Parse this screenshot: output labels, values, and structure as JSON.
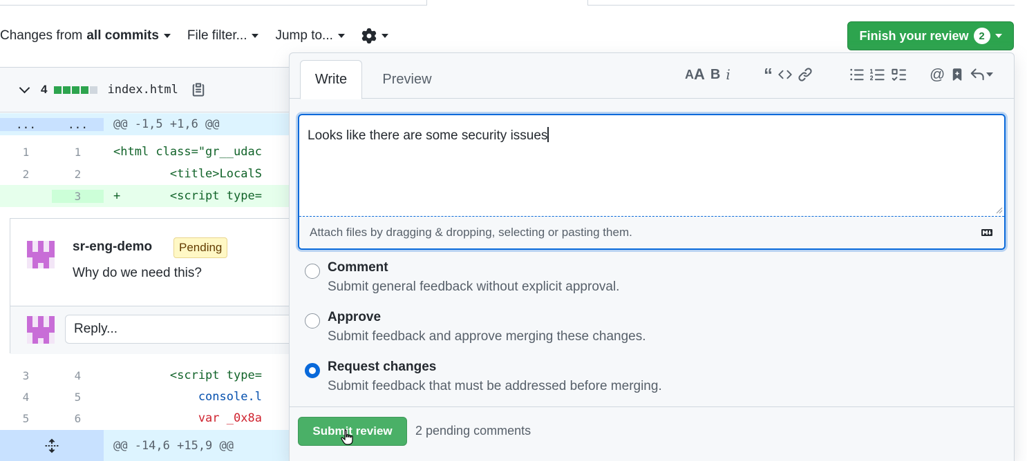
{
  "toolbar": {
    "changes_prefix": "Changes from",
    "changes_value": "all commits",
    "file_filter": "File filter...",
    "jump_to": "Jump to...",
    "finish_review": "Finish your review",
    "finish_count": "2"
  },
  "file": {
    "change_count": "4",
    "name": "index.html"
  },
  "diff_top": [
    {
      "type": "hunk",
      "old": "...",
      "new": "...",
      "code": "@@ -1,5 +1,6 @@"
    },
    {
      "type": "context",
      "old": "1",
      "new": "1",
      "code": "<html class=\"gr__udac"
    },
    {
      "type": "context",
      "old": "2",
      "new": "2",
      "code": "        <title>LocalS"
    },
    {
      "type": "added",
      "old": "",
      "new": "3",
      "code": "+       <script type="
    }
  ],
  "thread": {
    "author": "sr-eng-demo",
    "badge": "Pending",
    "body": "Why do we need this?",
    "reply_placeholder": "Reply..."
  },
  "diff_bottom": [
    {
      "type": "context",
      "old": "3",
      "new": "4",
      "code": "        <script type="
    },
    {
      "type": "context",
      "old": "4",
      "new": "5",
      "code": "            console.l"
    },
    {
      "type": "context",
      "old": "5",
      "new": "6",
      "code": "            var _0x8a"
    },
    {
      "type": "hunk",
      "old": "",
      "new": "",
      "code": "@@ -14,6 +15,9 @@"
    }
  ],
  "review": {
    "tabs": [
      "Write",
      "Preview"
    ],
    "text": "Looks like there are some security issues",
    "attach_hint": "Attach files by dragging & dropping, selecting or pasting them.",
    "options": [
      {
        "title": "Comment",
        "desc": "Submit general feedback without explicit approval.",
        "checked": false
      },
      {
        "title": "Approve",
        "desc": "Submit feedback and approve merging these changes.",
        "checked": false
      },
      {
        "title": "Request changes",
        "desc": "Submit feedback that must be addressed before merging.",
        "checked": true
      }
    ],
    "submit": "Submit review",
    "pending": "2 pending comments"
  },
  "colors": {
    "accent_green": "#2da44e",
    "focus_blue": "#0969da",
    "pending_yellow": "#fff8c5"
  }
}
